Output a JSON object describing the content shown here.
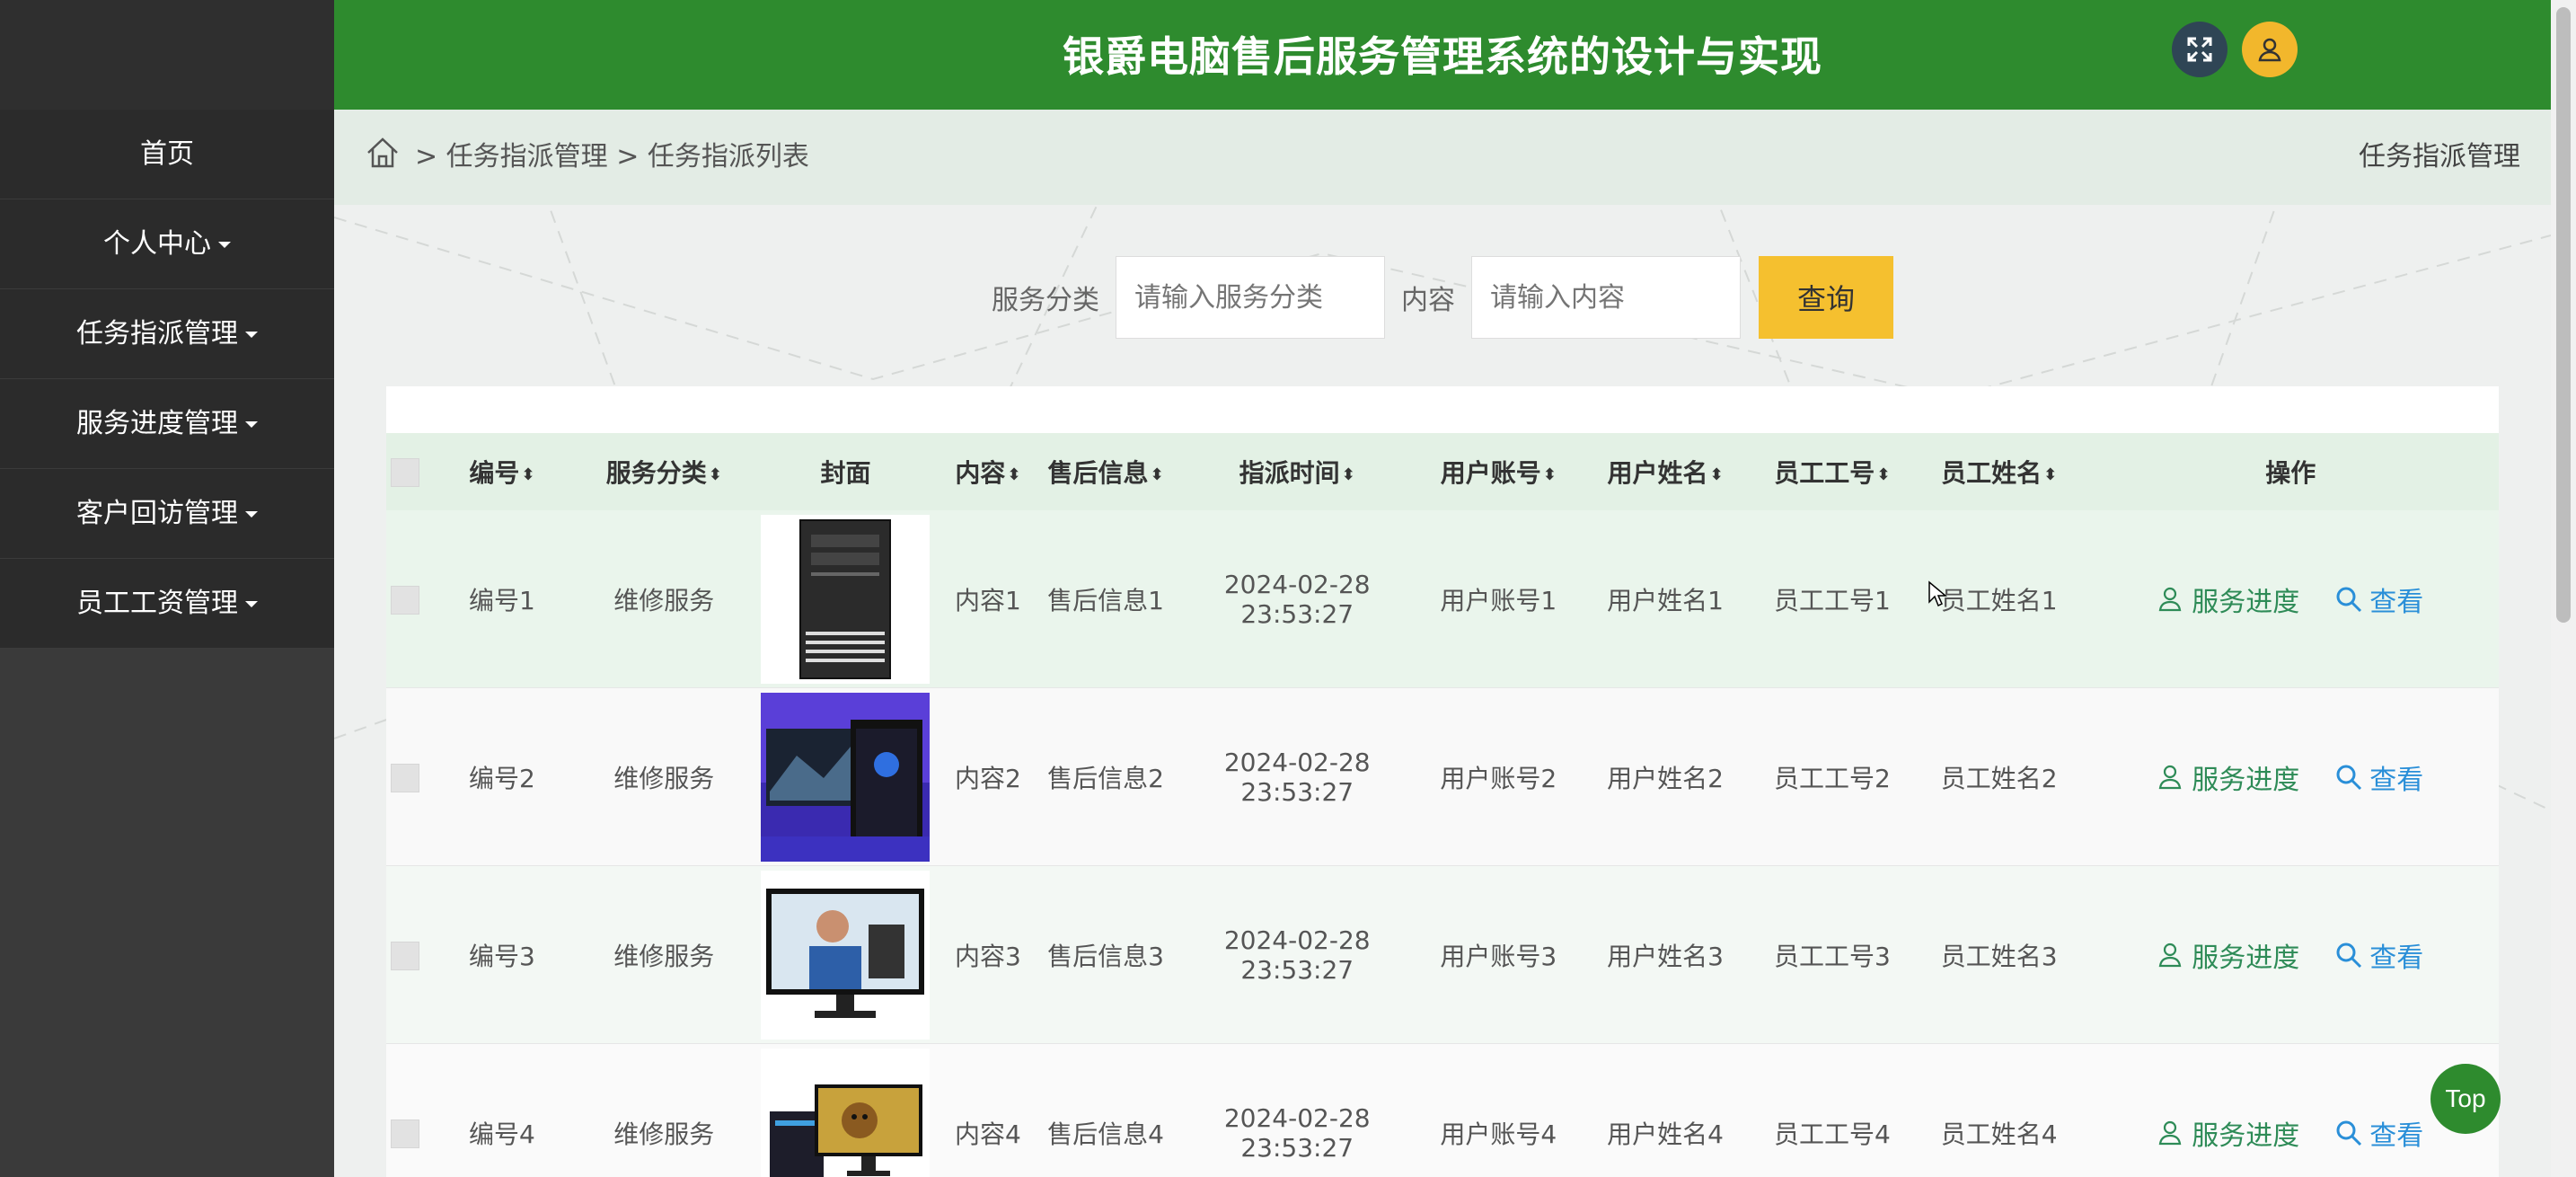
{
  "header": {
    "title": "银爵电脑售后服务管理系统的设计与实现"
  },
  "sidebar": {
    "items": [
      {
        "label": "首页",
        "has_caret": false
      },
      {
        "label": "个人中心",
        "has_caret": true
      },
      {
        "label": "任务指派管理",
        "has_caret": true
      },
      {
        "label": "服务进度管理",
        "has_caret": true
      },
      {
        "label": "客户回访管理",
        "has_caret": true
      },
      {
        "label": "员工工资管理",
        "has_caret": true
      }
    ]
  },
  "breadcrumb": {
    "path": "> 任务指派管理 > 任务指派列表",
    "right": "任务指派管理"
  },
  "search": {
    "category_label": "服务分类",
    "category_placeholder": "请输入服务分类",
    "content_label": "内容",
    "content_placeholder": "请输入内容",
    "button": "查询"
  },
  "table": {
    "headers": [
      "编号",
      "服务分类",
      "封面",
      "内容",
      "售后信息",
      "指派时间",
      "用户账号",
      "用户姓名",
      "员工工号",
      "员工姓名",
      "操作"
    ],
    "rows": [
      {
        "id": "编号1",
        "category": "维修服务",
        "content": "内容1",
        "info": "售后信息1",
        "time": "2024-02-28 23:53:27",
        "account": "用户账号1",
        "name": "用户姓名1",
        "staff_no": "员工工号1",
        "staff_name": "员工姓名1"
      },
      {
        "id": "编号2",
        "category": "维修服务",
        "content": "内容2",
        "info": "售后信息2",
        "time": "2024-02-28 23:53:27",
        "account": "用户账号2",
        "name": "用户姓名2",
        "staff_no": "员工工号2",
        "staff_name": "员工姓名2"
      },
      {
        "id": "编号3",
        "category": "维修服务",
        "content": "内容3",
        "info": "售后信息3",
        "time": "2024-02-28 23:53:27",
        "account": "用户账号3",
        "name": "用户姓名3",
        "staff_no": "员工工号3",
        "staff_name": "员工姓名3"
      },
      {
        "id": "编号4",
        "category": "维修服务",
        "content": "内容4",
        "info": "售后信息4",
        "time": "2024-02-28 23:53:27",
        "account": "用户账号4",
        "name": "用户姓名4",
        "staff_no": "员工工号4",
        "staff_name": "员工姓名4"
      }
    ],
    "actions": {
      "progress": "服务进度",
      "view": "查看"
    }
  },
  "top_button": "Top",
  "colors": {
    "header": "#2e8b2e",
    "sidebar": "#3a3a3a",
    "search_button": "#f5c02f",
    "action_green": "#2e8b57",
    "action_blue": "#2a8fd8"
  }
}
